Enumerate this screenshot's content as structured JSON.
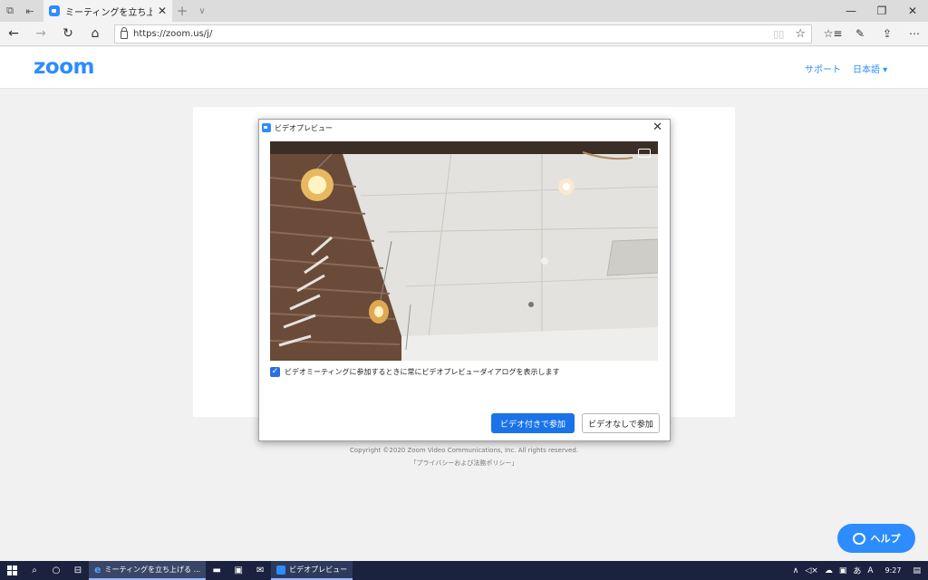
{
  "browser": {
    "tab_title": "ミーティングを立ち上げる - Z",
    "url": "https://zoom.us/j/"
  },
  "header": {
    "logo": "zoom",
    "support_link": "サポート",
    "language": "日本語 ▾"
  },
  "footer": {
    "copyright": "Copyright ©2020 Zoom Video Communications, Inc. All rights reserved.",
    "privacy": "「プライバシーおよび法務ポリシー」"
  },
  "dialog": {
    "title": "ビデオプレビュー",
    "checkbox_label": "ビデオミーティングに参加するときに常にビデオプレビューダイアログを表示します",
    "checkbox_checked": true,
    "join_with_video": "ビデオ付きで参加",
    "join_without_video": "ビデオなしで参加"
  },
  "help_button": "ヘルプ",
  "taskbar": {
    "edge_app": "ミーティングを立ち上げる ...",
    "zoom_app": "ビデオプレビュー",
    "ime": "あ",
    "clock": "9:27"
  },
  "colors": {
    "zoom_blue": "#2d8cff",
    "primary_button": "#1a73e8",
    "taskbar_bg": "#1b2240"
  }
}
